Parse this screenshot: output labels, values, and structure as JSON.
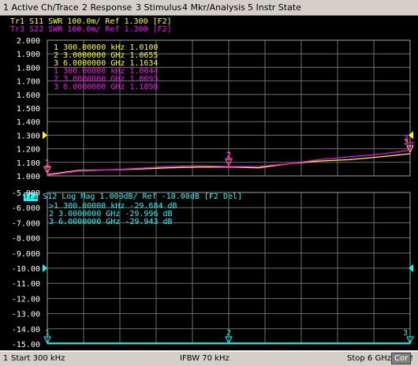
{
  "menubar": [
    "1 Active Ch/Trace",
    "2 Response",
    "3 Stimulus",
    "4 Mkr/Analysis",
    "5 Instr State"
  ],
  "colors": {
    "tr1": "#ffff00",
    "tr3": "#ff00ff",
    "tr2": "#00ffff",
    "grid": "#6e6e6e",
    "axis": "#ffffff"
  },
  "upper": {
    "tr1_header": "Tr1 S11 SWR 100.0m/ Ref 1.300 [F2]",
    "tr3_header": "Tr3 S22 SWR 100.0m/ Ref 1.300 [F2]",
    "yticks": [
      "2.000",
      "1.900",
      "1.800",
      "1.700",
      "1.600",
      "1.500",
      "1.400",
      "1.300",
      "1.200",
      "1.100",
      "1.000"
    ],
    "markers": [
      {
        "text": "1   300.00000 kHz  1.0100",
        "trace": "tr1"
      },
      {
        "text": "2   3.0000000 GHz  1.0655",
        "trace": "tr1"
      },
      {
        "text": "3   6.0000000 GHz  1.1634",
        "trace": "tr1"
      },
      {
        "text": "1   300.00000 kHz  1.0044",
        "trace": "tr3"
      },
      {
        "text": "2   3.0000000 GHz  1.0693",
        "trace": "tr3"
      },
      {
        "text": "3   6.0000000 GHz  1.1898",
        "trace": "tr3"
      }
    ]
  },
  "lower": {
    "tr2_label": "Tr2",
    "tr2_header": " S12 Log Mag 1.000dB/ Ref -10.00dB [F2 Del]",
    "yticks": [
      "-5.000",
      "-6.000",
      "-7.000",
      "-8.000",
      "-9.000",
      "-10.00",
      "-11.00",
      "-12.00",
      "-13.00",
      "-14.00",
      "-15.00"
    ],
    "markers": [
      ">1   300.00000 kHz -29.684 dB",
      " 2   3.0000000 GHz -29.996 dB",
      " 3   6.0000000 GHz -29.943 dB"
    ]
  },
  "chart_data": [
    {
      "type": "line",
      "title": "Tr1 S11 SWR 100.0m/ Ref 1.300 [F2]",
      "xlabel": "",
      "ylabel": "",
      "xlim": [
        0.0003,
        6
      ],
      "ylim": [
        1.0,
        2.0
      ],
      "series": [
        {
          "name": "Tr1 S11",
          "x": [
            0.0003,
            0.5,
            1,
            1.5,
            2,
            2.5,
            3,
            3.5,
            4,
            4.5,
            5,
            5.5,
            6
          ],
          "values": [
            1.01,
            1.04,
            1.045,
            1.05,
            1.06,
            1.065,
            1.0655,
            1.06,
            1.09,
            1.11,
            1.12,
            1.14,
            1.1634
          ]
        },
        {
          "name": "Tr3 S22",
          "x": [
            0.0003,
            0.5,
            1,
            1.5,
            2,
            2.5,
            3,
            3.5,
            4,
            4.5,
            5,
            5.5,
            6
          ],
          "values": [
            1.0044,
            1.035,
            1.045,
            1.055,
            1.07,
            1.075,
            1.0693,
            1.07,
            1.09,
            1.12,
            1.14,
            1.16,
            1.1898
          ]
        }
      ]
    },
    {
      "type": "line",
      "title": "Tr2 S12 Log Mag 1.000dB/ Ref -10.00dB [F2 Del]",
      "xlabel": "",
      "ylabel": "",
      "xlim": [
        0.0003,
        6
      ],
      "ylim": [
        -15.0,
        -5.0
      ],
      "series": [
        {
          "name": "Tr2 S12",
          "x": [
            0.0003,
            3,
            6
          ],
          "values": [
            -29.684,
            -29.996,
            -29.943
          ]
        }
      ]
    }
  ],
  "status": {
    "channel": "1",
    "start": "Start 300 kHz",
    "ifbw": "IFBW 70 kHz",
    "stop": "Stop 6 GHz",
    "cor": "Cor",
    "extra": "!"
  }
}
